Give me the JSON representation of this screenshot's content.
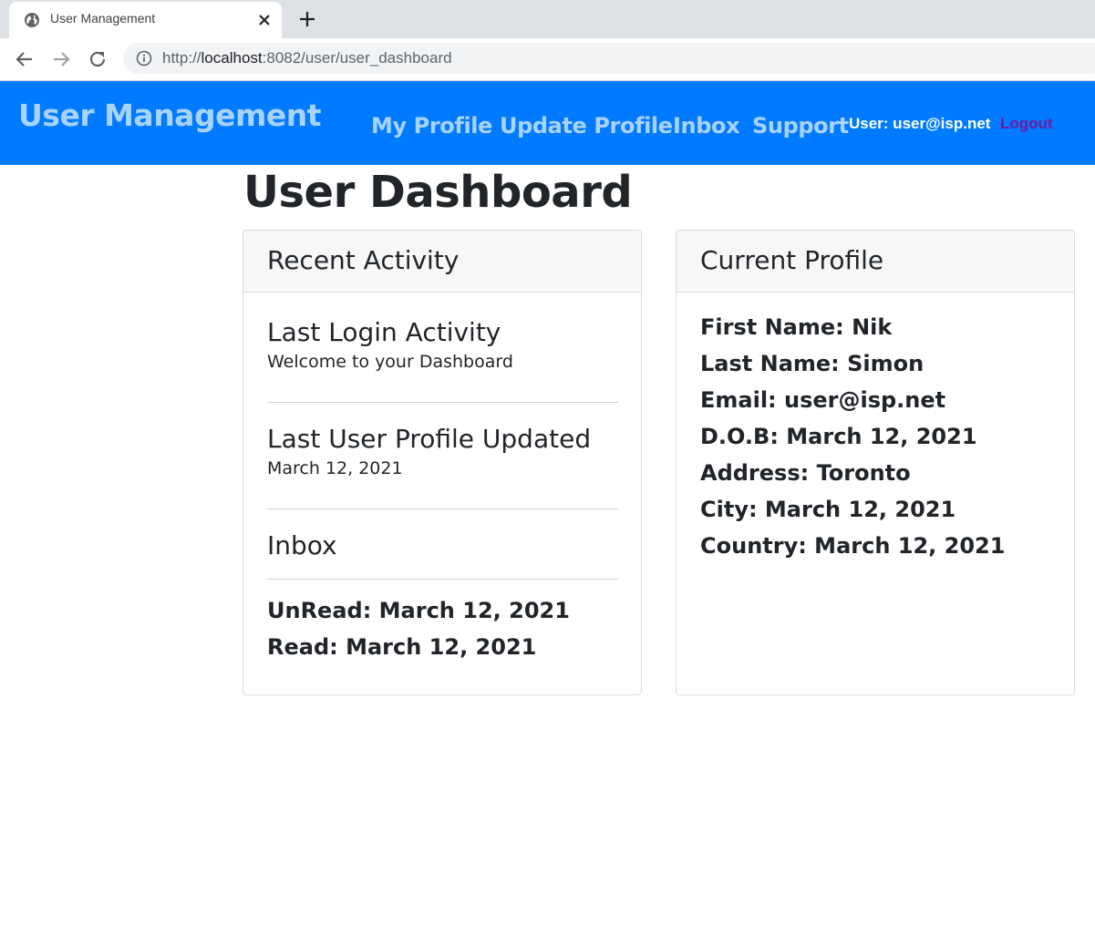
{
  "browser": {
    "tab_title": "User Management",
    "url_prefix": "http://",
    "url_host": "localhost",
    "url_path": ":8082/user/user_dashboard",
    "icons": [
      "globe-icon",
      "close-icon",
      "plus-icon",
      "back-arrow-icon",
      "forward-arrow-icon",
      "reload-icon",
      "info-icon"
    ]
  },
  "navbar": {
    "brand": "User Management",
    "links": [
      "My Profile",
      "Update Profile",
      "Inbox",
      "Support"
    ],
    "user_label": "User: user@isp.net",
    "logout": "Logout",
    "colors": {
      "bar": "#007bff",
      "link": "#a8d2ff",
      "logout": "#6f1aa0"
    }
  },
  "page": {
    "title": "User Dashboard"
  },
  "recent_activity": {
    "header": "Recent Activity",
    "last_login_title": "Last Login Activity",
    "last_login_text": "Welcome to your Dashboard",
    "last_update_title": "Last User Profile Updated",
    "last_update_text": "March 12, 2021",
    "inbox_title": "Inbox",
    "unread": "UnRead: March 12, 2021",
    "read": "Read: March 12, 2021"
  },
  "current_profile": {
    "header": "Current Profile",
    "fields": [
      "First Name: Nik",
      "Last Name: Simon",
      "Email: user@isp.net",
      "D.O.B: March 12, 2021",
      "Address: Toronto",
      "City: March 12, 2021",
      "Country: March 12, 2021"
    ]
  }
}
